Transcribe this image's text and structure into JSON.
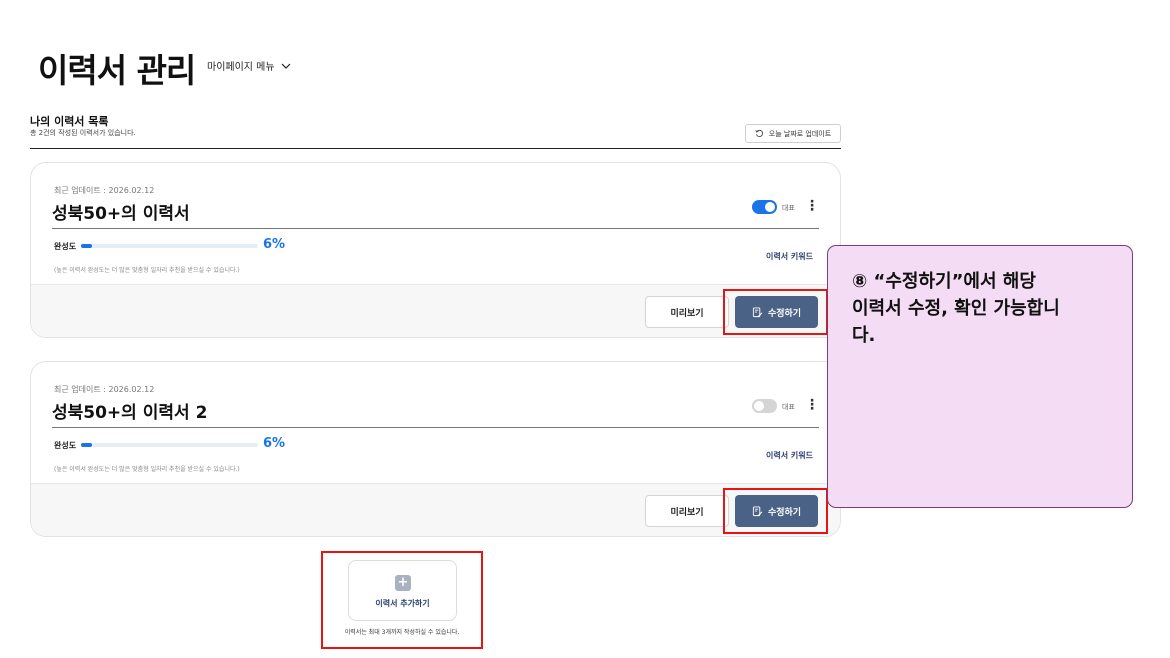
{
  "page": {
    "title": "이력서 관리",
    "mypage_menu": "마이페이지 메뉴"
  },
  "list": {
    "title": "나의 이력서 목록",
    "subtitle": "총 2건의 작성된 이력서가 있습니다.",
    "update_button": "오늘 날짜로 업데이트"
  },
  "resumes": [
    {
      "updated": "최근 업데이트 : 2026.02.12",
      "title": "성북50+의 이력서",
      "representative": true,
      "rep_label": "대표",
      "completion_label": "완성도",
      "completion_percent": 6,
      "completion_text": "6%",
      "note": "(높은 이력서 완성도는 더 많은 맞춤형 일자리 추천을 받으실 수 있습니다.)",
      "keyword_link": "이력서 키워드",
      "preview_label": "미리보기",
      "edit_label": "수정하기"
    },
    {
      "updated": "최근 업데이트 : 2026.02.12",
      "title": "성북50+의 이력서 2",
      "representative": false,
      "rep_label": "대표",
      "completion_label": "완성도",
      "completion_percent": 6,
      "completion_text": "6%",
      "note": "(높은 이력서 완성도는 더 많은 맞춤형 일자리 추천을 받으실 수 있습니다.)",
      "keyword_link": "이력서 키워드",
      "preview_label": "미리보기",
      "edit_label": "수정하기"
    }
  ],
  "add_resume": {
    "label": "이력서 추가하기",
    "note": "이력서는 최대 3개까지 작성하실 수 있습니다."
  },
  "callout": {
    "text": "⑧ “수정하기”에서 해당\n 이력서 수정, 확인 가능합니\n다."
  },
  "colors": {
    "accent": "#1a73e8",
    "edit_button": "#4b6287",
    "highlight": "#e51515",
    "callout_bg": "#f4dcf4"
  },
  "icons": {
    "menu": "chevron-down-icon",
    "update": "refresh-icon",
    "edit": "edit-document-icon",
    "more": "kebab-icon",
    "add": "plus-icon"
  }
}
